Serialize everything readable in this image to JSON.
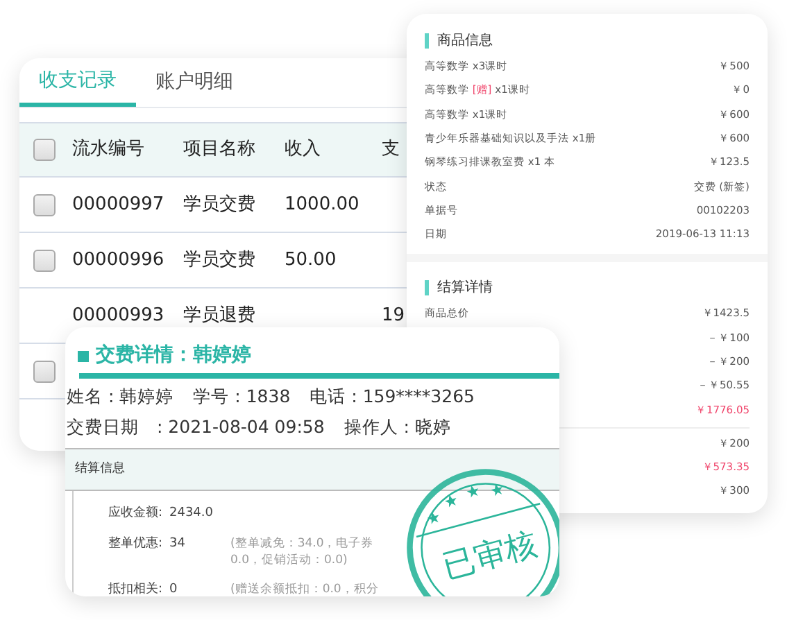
{
  "records_card": {
    "tabs": [
      {
        "label": "收支记录",
        "selected": true
      },
      {
        "label": "账户明细",
        "selected": false
      }
    ],
    "header_checkbox": {
      "checked": false
    },
    "columns": [
      "流水编号",
      "项目名称",
      "收入",
      "支"
    ],
    "rows": [
      {
        "checkbox": {
          "checked": false
        },
        "cells": [
          "00000997",
          "学员交费",
          "1000.00",
          ""
        ]
      },
      {
        "checkbox": {
          "checked": false
        },
        "cells": [
          "00000996",
          "学员交费",
          "50.00",
          ""
        ]
      },
      {
        "cells": [
          "00000993",
          "学员退费",
          "",
          "19"
        ]
      },
      {
        "checkbox": {
          "checked": false
        }
      }
    ]
  },
  "product_card": {
    "title": "商品信息",
    "items": [
      {
        "label": "高等数学 x3课时",
        "value": "￥500"
      },
      {
        "label": "高等数学",
        "tag": "[赠]",
        "label_after": "x1课时",
        "value": "￥0"
      },
      {
        "label": "高等数学 x1课时",
        "value": "￥600"
      },
      {
        "label": "青少年乐器基础知识以及手法 x1册",
        "value": "￥600"
      },
      {
        "label": "钢琴练习排课教室费 x1 本",
        "value": "￥123.5"
      },
      {
        "label": "状态",
        "value": "交费 (新签)"
      },
      {
        "label": "单据号",
        "value": "00102203"
      },
      {
        "label": "日期",
        "value": "2019-06-13 11:13"
      }
    ],
    "settlement_title": "结算详情",
    "settlement_groups": [
      [
        {
          "label": "商品总价",
          "value": "￥1423.5",
          "highlight": false
        },
        {
          "value": "－￥100",
          "highlight": false
        },
        {
          "value": "－￥200",
          "highlight": false
        },
        {
          "value": "－￥50.55",
          "highlight": false
        },
        {
          "value": "￥1776.05",
          "highlight": true
        }
      ],
      [
        {
          "value": "￥200",
          "highlight": false
        },
        {
          "value": "￥573.35",
          "highlight": true
        },
        {
          "value": "￥300",
          "highlight": false
        }
      ]
    ]
  },
  "payment_card": {
    "title": "交费详情：韩婷婷",
    "info_lines": [
      [
        "姓名 : 韩婷婷",
        "学号 : 1838",
        "电话 : 159****3265"
      ],
      [
        "交费日期　: 2021-08-04 09:58",
        "操作人 : 晓婷"
      ]
    ],
    "section_title": "结算信息",
    "amounts": [
      {
        "label": "应收金额:",
        "value": "2434.0"
      },
      {
        "label": "整单优惠:",
        "value": "34",
        "note": "(整单减免：34.0，电子券 0.0，促销活动：0.0)"
      },
      {
        "label": "抵扣相关:",
        "value": "0",
        "note": "(赠送余额抵扣：0.0，积分"
      }
    ],
    "stamp": {
      "text": "已审核"
    }
  }
}
